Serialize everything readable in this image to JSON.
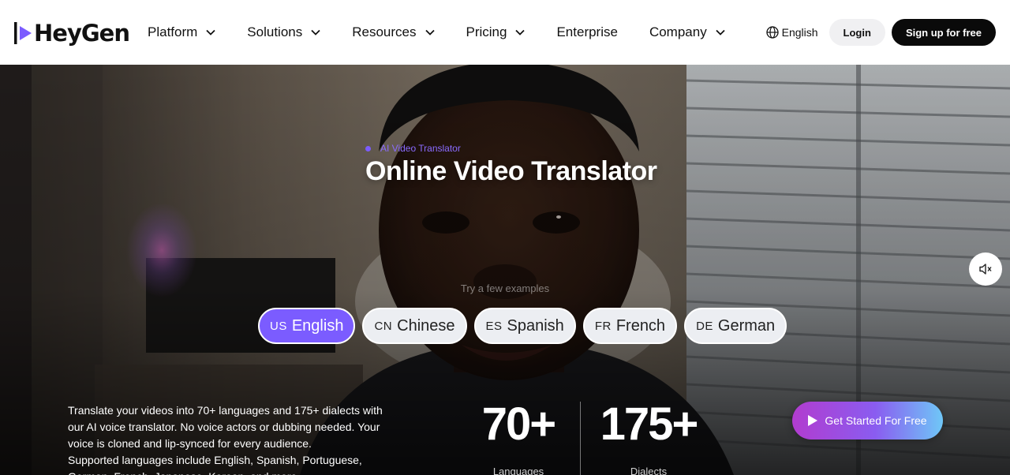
{
  "brand": {
    "name": "HeyGen",
    "wordmark": "HeyGen",
    "accent": "#7b5cff"
  },
  "nav": {
    "items": [
      {
        "label": "Platform",
        "has_dropdown": true
      },
      {
        "label": "Solutions",
        "has_dropdown": true
      },
      {
        "label": "Resources",
        "has_dropdown": true
      },
      {
        "label": "Pricing",
        "has_dropdown": true
      },
      {
        "label": "Enterprise",
        "has_dropdown": false
      },
      {
        "label": "Company",
        "has_dropdown": true
      }
    ],
    "language": "English",
    "login_label": "Login",
    "signup_label": "Sign up for free"
  },
  "hero": {
    "eyebrow": "AI Video Translator",
    "title": "Online Video Translator",
    "examples_label": "Try a few examples",
    "languages": [
      {
        "code": "US",
        "label": "English",
        "active": true
      },
      {
        "code": "CN",
        "label": "Chinese",
        "active": false
      },
      {
        "code": "ES",
        "label": "Spanish",
        "active": false
      },
      {
        "code": "FR",
        "label": "French",
        "active": false
      },
      {
        "code": "DE",
        "label": "German",
        "active": false
      }
    ],
    "description_1": "Translate your videos into 70+ languages and 175+ dialects with our AI voice translator. No voice actors or dubbing needed. Your voice is cloned and lip-synced for every audience.",
    "description_2": "Supported languages include English, Spanish, Portuguese, German, French, Japanese, Korean, and more.",
    "stats": [
      {
        "value": "70+",
        "label": "Languages"
      },
      {
        "value": "175+",
        "label": "Dialects"
      }
    ],
    "cta_label": "Get Started For Free",
    "mute_icon": "speaker-muted-icon"
  }
}
